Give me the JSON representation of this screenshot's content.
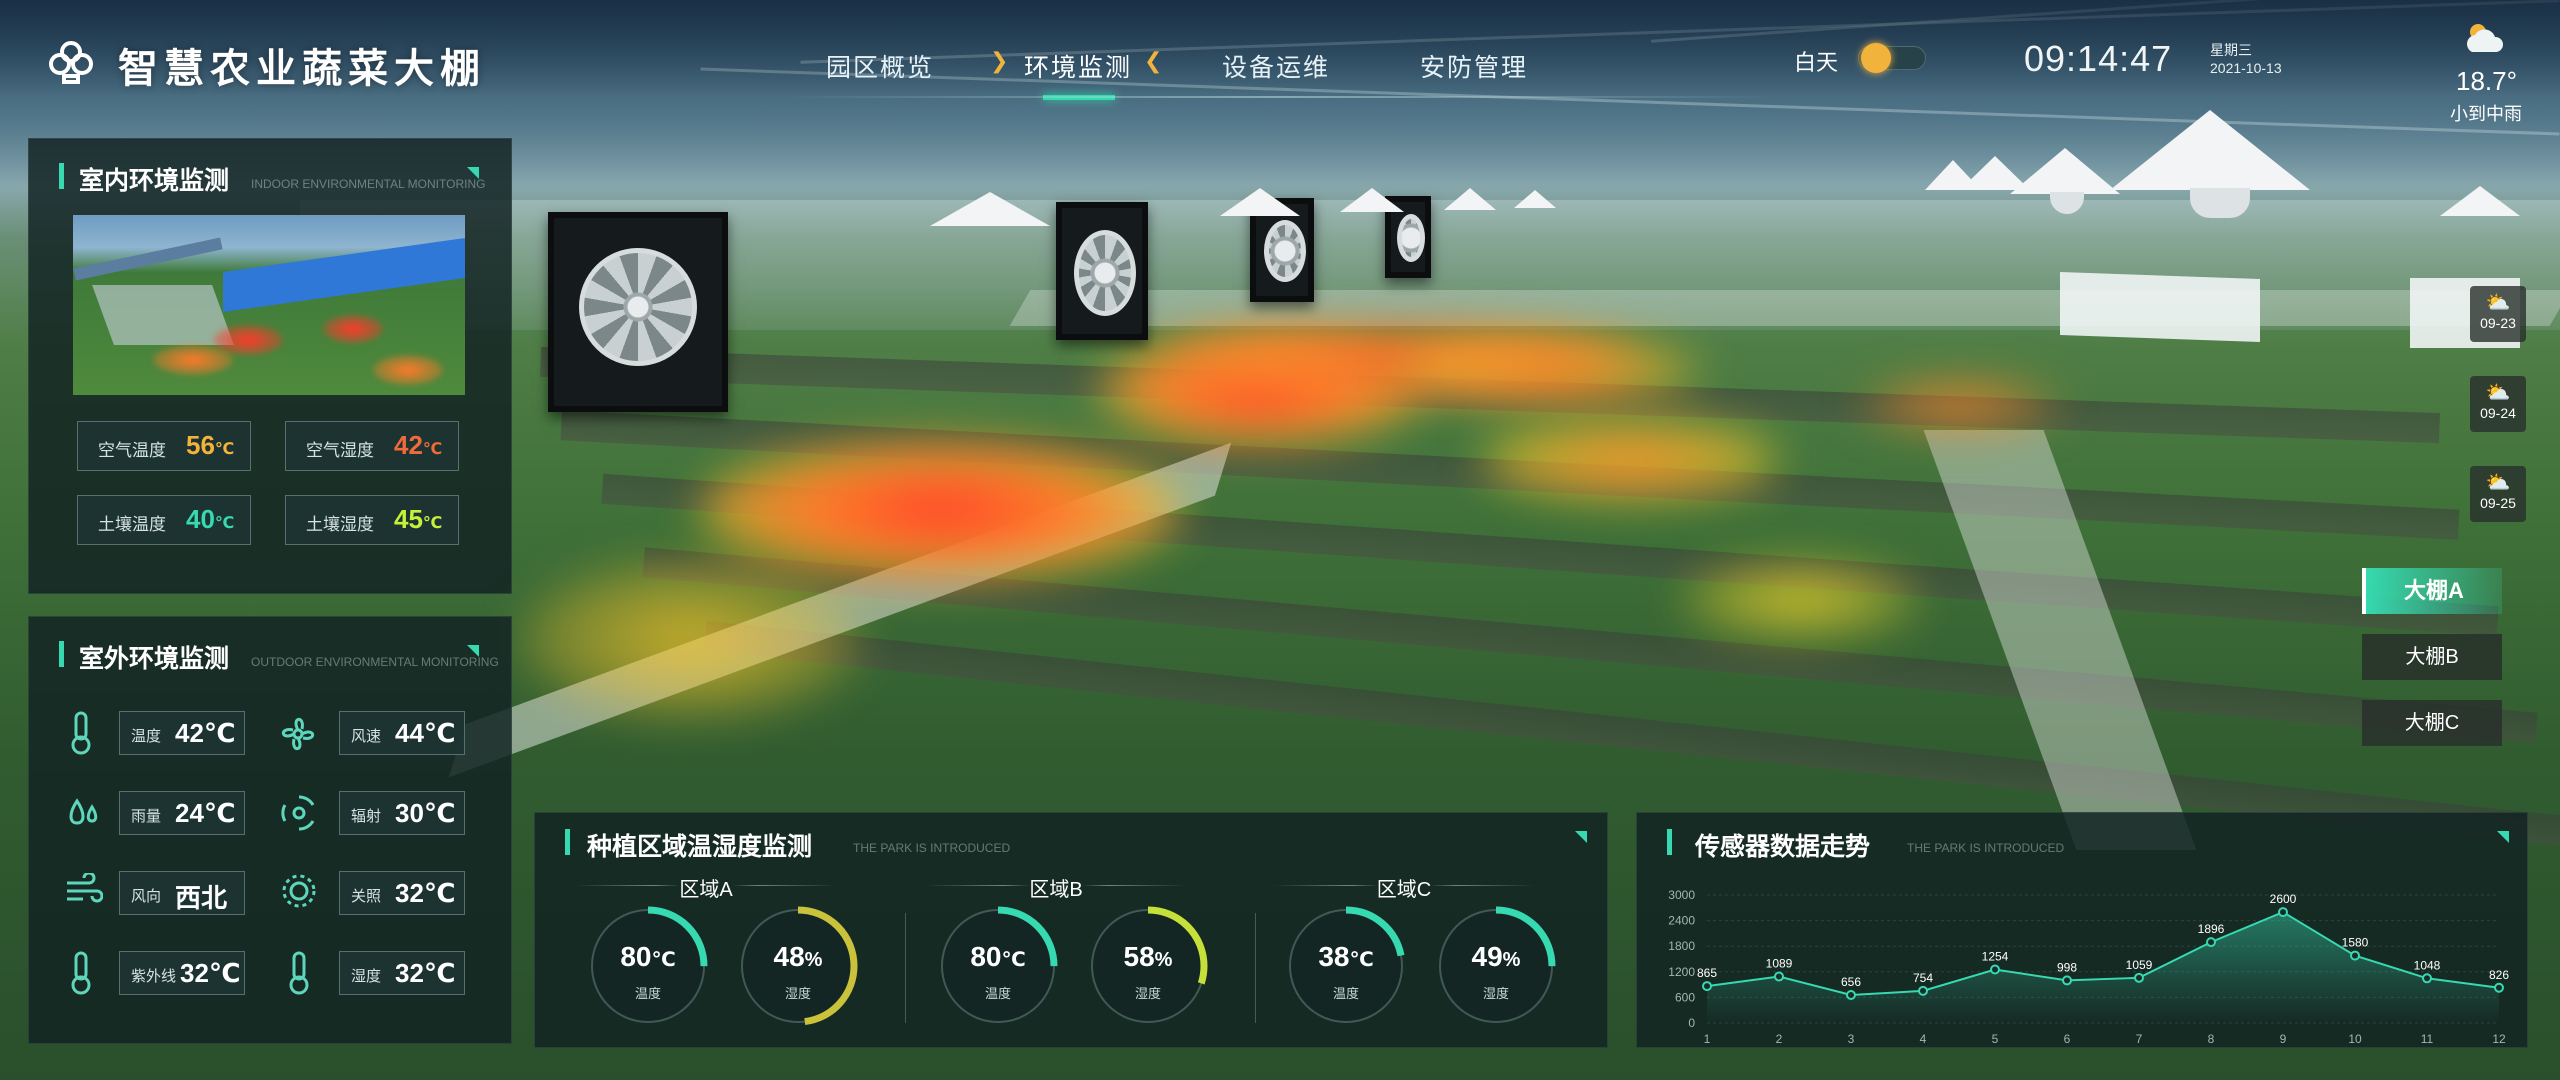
{
  "header": {
    "title": "智慧农业蔬菜大棚",
    "nav": [
      "园区概览",
      "环境监测",
      "设备运维",
      "安防管理"
    ],
    "active_nav": "环境监测",
    "day_mode_label": "白天",
    "time": "09:14:47",
    "weekday": "星期三",
    "date": "2021-10-13",
    "weather": {
      "temperature": "18.7°",
      "description": "小到中雨"
    }
  },
  "forecast": [
    {
      "date": "09-23",
      "icon": "cloud-sun-icon"
    },
    {
      "date": "09-24",
      "icon": "cloud-sun-icon"
    },
    {
      "date": "09-25",
      "icon": "cloud-sun-icon"
    }
  ],
  "greenhouses": {
    "items": [
      "大棚A",
      "大棚B",
      "大棚C"
    ],
    "selected": "大棚A"
  },
  "indoor": {
    "title": "室内环境监测",
    "subtitle": "INDOOR ENVIRONMENTAL MONITORING",
    "metrics": [
      {
        "label": "空气温度",
        "value": "56",
        "unit": "℃",
        "color": "#f3b23a"
      },
      {
        "label": "空气湿度",
        "value": "42",
        "unit": "℃",
        "color": "#f06a3a"
      },
      {
        "label": "土壤温度",
        "value": "40",
        "unit": "℃",
        "color": "#36d9b0"
      },
      {
        "label": "土壤湿度",
        "value": "45",
        "unit": "℃",
        "color": "#c6f03a"
      }
    ]
  },
  "outdoor": {
    "title": "室外环境监测",
    "subtitle": "OUTDOOR ENVIRONMENTAL MONITORING",
    "metrics": [
      {
        "label": "温度",
        "value": "42℃",
        "icon": "thermometer-icon"
      },
      {
        "label": "风速",
        "value": "44℃",
        "icon": "fan-icon"
      },
      {
        "label": "雨量",
        "value": "24℃",
        "icon": "rain-drops-icon"
      },
      {
        "label": "辐射",
        "value": "30℃",
        "icon": "radiation-icon"
      },
      {
        "label": "风向",
        "value": "西北",
        "icon": "wind-direction-icon"
      },
      {
        "label": "关照",
        "value": "32℃",
        "icon": "sun-light-icon"
      },
      {
        "label": "紫外线",
        "value": "32℃",
        "icon": "thermometer-icon"
      },
      {
        "label": "湿度",
        "value": "32℃",
        "icon": "thermometer-icon"
      }
    ]
  },
  "planting": {
    "title": "种植区域温湿度监测",
    "subtitle": "THE PARK IS INTRODUCED",
    "zones": [
      {
        "name": "区域A",
        "temp": {
          "value": "80",
          "unit": "℃",
          "label": "温度",
          "fraction": 0.25,
          "color": "#36d9b0"
        },
        "humidity": {
          "value": "48",
          "unit": "%",
          "label": "湿度",
          "fraction": 0.48,
          "color": "#c9c23a"
        }
      },
      {
        "name": "区域B",
        "temp": {
          "value": "80",
          "unit": "℃",
          "label": "温度",
          "fraction": 0.25,
          "color": "#36d9b0"
        },
        "humidity": {
          "value": "58",
          "unit": "%",
          "label": "湿度",
          "fraction": 0.3,
          "color": "#c6e03a"
        }
      },
      {
        "name": "区域C",
        "temp": {
          "value": "38",
          "unit": "℃",
          "label": "温度",
          "fraction": 0.22,
          "color": "#36d9b0"
        },
        "humidity": {
          "value": "49",
          "unit": "%",
          "label": "湿度",
          "fraction": 0.25,
          "color": "#36d9b0"
        }
      }
    ]
  },
  "sensor": {
    "title": "传感器数据走势",
    "subtitle": "THE PARK IS INTRODUCED"
  },
  "chart_data": {
    "type": "area",
    "title": "传感器数据走势",
    "x": [
      "1",
      "2",
      "3",
      "4",
      "5",
      "6",
      "7",
      "8",
      "9",
      "10",
      "11",
      "12"
    ],
    "values": [
      865,
      1089,
      656,
      754,
      1254,
      998,
      1059,
      1896,
      2600,
      1580,
      1048,
      826
    ],
    "yticks": [
      "0",
      "600",
      "1200",
      "1800",
      "2400",
      "3000"
    ],
    "ylim": [
      0,
      3000
    ],
    "grid": true,
    "color": "#36d9b0"
  }
}
